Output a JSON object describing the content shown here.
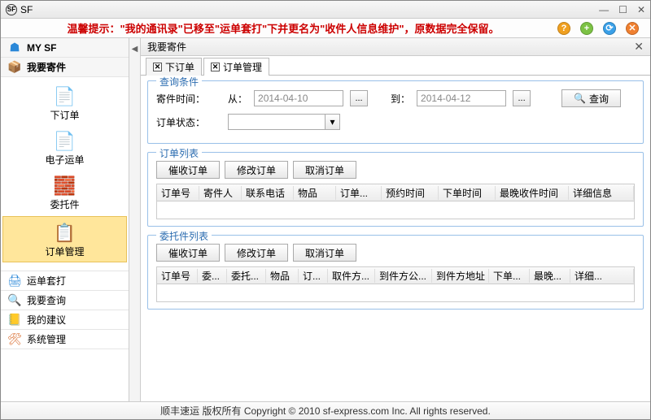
{
  "window": {
    "title": "SF"
  },
  "tip": {
    "prefix": "温馨提示：",
    "body": "\"我的通讯录\"已移至\"运单套打\"下并更名为\"收件人信息维护\"，原数据完全保留。"
  },
  "toolbar_circles": [
    {
      "color": "#f0a020",
      "glyph": "?"
    },
    {
      "color": "#7cc244",
      "glyph": "+"
    },
    {
      "color": "#3aa0e8",
      "glyph": "⟳"
    },
    {
      "color": "#f08030",
      "glyph": "✕"
    }
  ],
  "sidebar": {
    "my_sf": "MY SF",
    "send": "我要寄件",
    "sub": {
      "place_order": "下订单",
      "e_waybill": "电子运单",
      "entrust": "委托件",
      "order_manage": "订单管理"
    },
    "batch_print": "运单套打",
    "my_query": "我要查询",
    "my_suggestion": "我的建议",
    "sys_manage": "系统管理"
  },
  "main": {
    "title": "我要寄件",
    "tabs": {
      "t1": "下订单",
      "t2": "订单管理"
    },
    "query": {
      "legend": "查询条件",
      "time_label": "寄件时间：",
      "from_label": "从：",
      "from_date": "2014-04-10",
      "to_label": "到：",
      "to_date": "2014-04-12",
      "search_btn": "查询",
      "status_label": "订单状态："
    },
    "orders": {
      "legend": "订单列表",
      "btn1": "催收订单",
      "btn2": "修改订单",
      "btn3": "取消订单",
      "cols": [
        "订单号",
        "寄件人",
        "联系电话",
        "物品",
        "订单...",
        "预约时间",
        "下单时间",
        "最晚收件时间",
        "详细信息"
      ]
    },
    "entrust": {
      "legend": "委托件列表",
      "btn1": "催收订单",
      "btn2": "修改订单",
      "btn3": "取消订单",
      "cols": [
        "订单号",
        "委...",
        "委托...",
        "物品",
        "订...",
        "取件方...",
        "到件方公...",
        "到件方地址",
        "下单...",
        "最晚...",
        "详细..."
      ]
    }
  },
  "footer": "顺丰速运 版权所有 Copyright © 2010 sf-express.com Inc. All rights reserved."
}
